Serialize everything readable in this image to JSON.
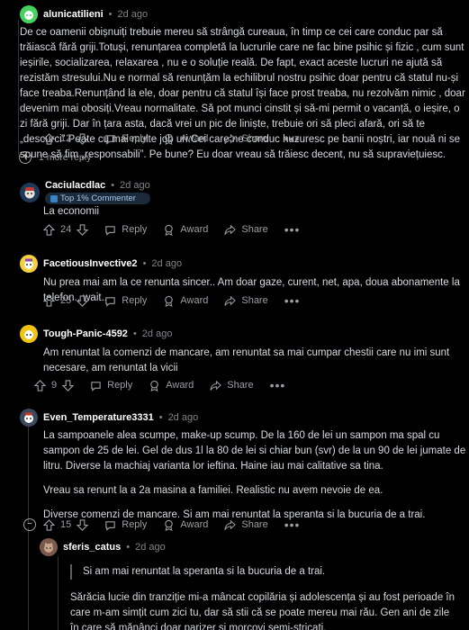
{
  "comments": [
    {
      "username": "alunicatilieni",
      "age": "2d ago",
      "body": [
        "De ce oamenii obișnuiți trebuie mereu să strângă cureaua, în timp ce cei care conduc par să trăiască fără griji.Totuși, renunțarea completă la lucrurile care ne fac bine psihic și fizic , cum sunt ieșirile, socializarea, relaxarea , nu e o soluție reală. De fapt, exact aceste lucruri ne ajută să rezistăm stresului.Nu e normal să renunțăm la echilibrul nostru psihic doar pentru că statul nu-și face treaba.Renunțând la ele, doar pentru că statul își face prost treaba, nu rezolvăm nimic , doar devenim mai obosiți.Vreau normalitate. Să pot munci cinstit și să-mi permit o vacanță, o ieșire, o zi fără griji. Dar în țara asta, dacă vrei un pic de liniște, trebuie ori să pleci afară, ori să te „descurci” Poate cu mai multe job uri.Cei care ne conduc huzuresc pe banii noștri, iar nouă ni se spune să fim „responsabili”. Pe bune? Eu doar vreau să trăiesc decent, nu să supraviețuiesc."
      ],
      "votes": "12",
      "more_replies": "1 more reply"
    },
    {
      "username": "Caciulacdlac",
      "age": "2d ago",
      "badge": "Top 1% Commenter",
      "body": [
        "La economii"
      ],
      "votes": "24"
    },
    {
      "username": "FacetiousInvective2",
      "age": "2d ago",
      "body": [
        "Nu prea mai am la ce renunta sincer.. Am doar gaze, curent, net, apa, doua abonamente la telefon.. wait.."
      ],
      "votes": "25"
    },
    {
      "username": "Tough-Panic-4592",
      "age": "2d ago",
      "body": [
        "Am renuntat la comenzi de mancare, am renuntat sa mai cumpar chestii care nu imi sunt necesare, am renuntat la vicii"
      ],
      "votes": "9"
    },
    {
      "username": "Even_Temperature3331",
      "age": "2d ago",
      "body": [
        "La sampoanele alea scumpe, make-up scump. De la 160 de lei un sampon ma spal cu sampon de 25 de lei. Gel de dus 1l la 80 de lei si chiar bun (svr) de la un 90 de lei jumate de litru. Diverse la machiaj varianta lor ieftina. Haine iau mai calitative sa tina.",
        "Vreau sa renunt la a 2a masina a familiei. Realistic nu avem nevoie de ea.",
        "Diverse comenzi de mancare. Si am mai renuntat la speranta si la bucuria de a trai."
      ],
      "votes": "15"
    },
    {
      "username": "sferis_catus",
      "age": "2d ago",
      "quote": "Si am mai renuntat la speranta si la bucuria de a trai.",
      "body": [
        "Sărăcia lucie din tranziție mi-a mâncat copilăria și adolescența și au fost perioade în care m-am simțit cum zici tu, dar să stii că se poate mereu mai rău. Gen ani de zile în care să mănânci doar parizer și morcovi semi-stricați."
      ]
    }
  ],
  "actions": {
    "reply": "Reply",
    "award": "Award",
    "share": "Share",
    "more": "•••"
  },
  "colors": {
    "bg": "#000000",
    "text": "#d7dadc",
    "muted": "#818384",
    "line": "#2f3336"
  }
}
